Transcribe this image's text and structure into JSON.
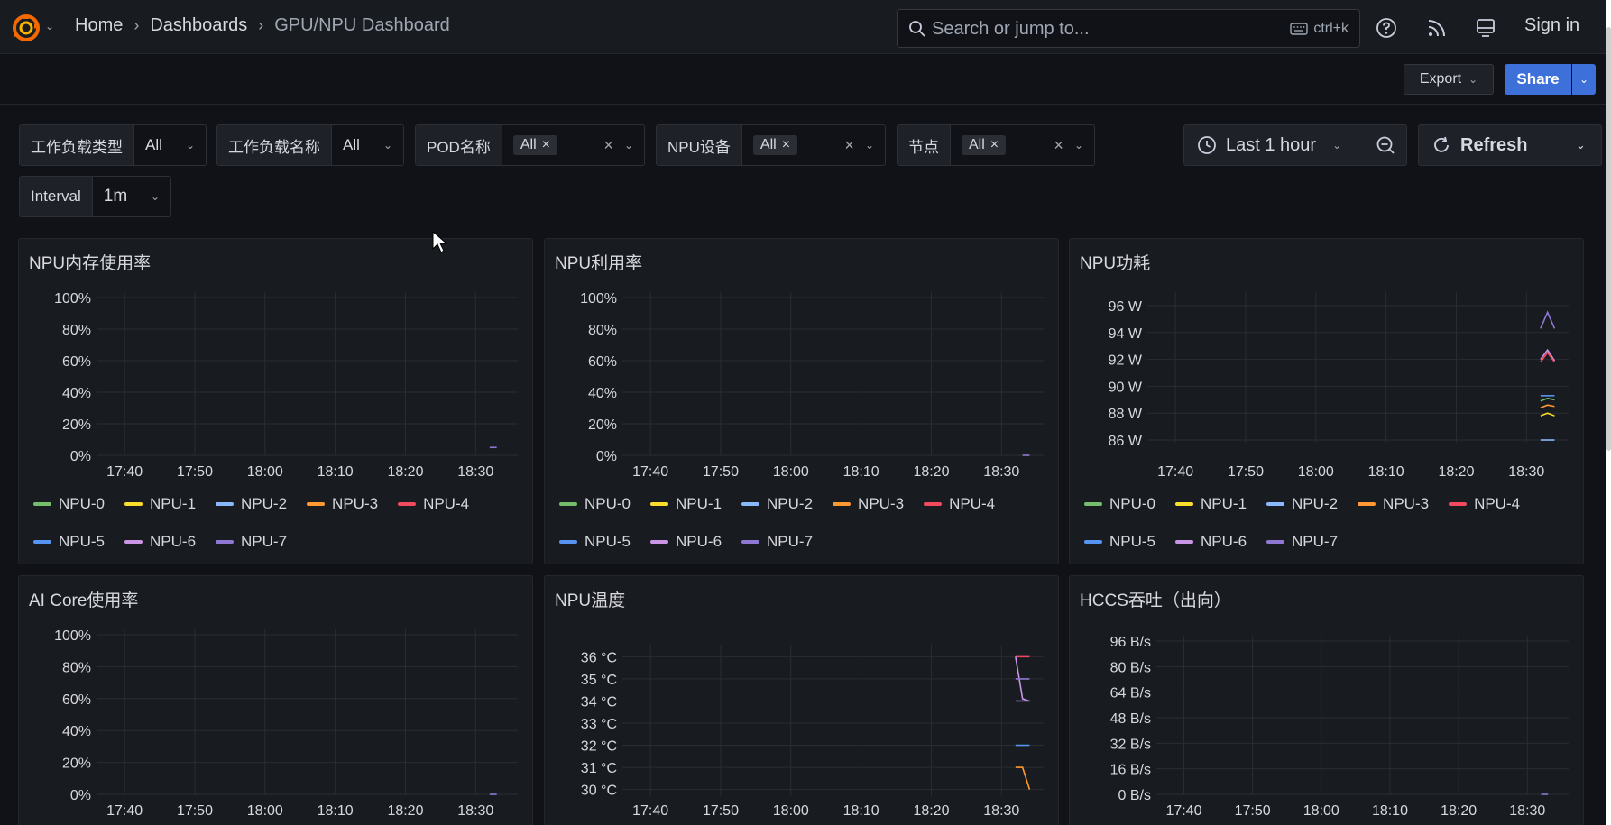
{
  "colors": {
    "bg": "#111217",
    "panel": "#181b1f",
    "accent": "#3d71d9",
    "logo": "#f46800"
  },
  "header": {
    "breadcrumb": [
      "Home",
      "Dashboards",
      "GPU/NPU Dashboard"
    ],
    "search_placeholder": "Search or jump to...",
    "search_shortcut": "ctrl+k",
    "icons": [
      "help-icon",
      "rss-icon",
      "kiosk-icon"
    ],
    "signin_label": "Sign in"
  },
  "toolbar": {
    "export_label": "Export",
    "share_label": "Share"
  },
  "variables": [
    {
      "label": "工作负载类型",
      "value": "All",
      "chip": false
    },
    {
      "label": "工作负载名称",
      "value": "All",
      "chip": false
    },
    {
      "label": "POD名称",
      "value": "All",
      "chip": true
    },
    {
      "label": "NPU设备",
      "value": "All",
      "chip": true
    },
    {
      "label": "节点",
      "value": "All",
      "chip": true
    },
    {
      "label": "Interval",
      "value": "1m",
      "chip": false
    }
  ],
  "time": {
    "range_label": "Last 1 hour",
    "refresh_label": "Refresh"
  },
  "series_names": [
    "NPU-0",
    "NPU-1",
    "NPU-2",
    "NPU-3",
    "NPU-4",
    "NPU-5",
    "NPU-6",
    "NPU-7"
  ],
  "series_colors": [
    "#73bf69",
    "#fade2a",
    "#8ab8ff",
    "#ff9830",
    "#f2495c",
    "#5794f2",
    "#ca95e5",
    "#8f78d3"
  ],
  "panels": [
    {
      "title": "NPU内存使用率",
      "legend": true
    },
    {
      "title": "NPU利用率",
      "legend": true
    },
    {
      "title": "NPU功耗",
      "legend": true
    },
    {
      "title": "AI Core使用率",
      "legend": false
    },
    {
      "title": "NPU温度",
      "legend": false
    },
    {
      "title": "HCCS吞吐（出向）",
      "legend": false
    }
  ],
  "chart_data": [
    {
      "type": "line",
      "title": "NPU内存使用率",
      "x_ticks": [
        "17:40",
        "17:50",
        "18:00",
        "18:10",
        "18:20",
        "18:30"
      ],
      "y_ticks": [
        "0%",
        "20%",
        "40%",
        "60%",
        "80%",
        "100%"
      ],
      "ylim": [
        0,
        100
      ],
      "series": [
        {
          "name": "NPU-7",
          "x": [
            "18:32",
            "18:33"
          ],
          "values": [
            5,
            5
          ]
        }
      ]
    },
    {
      "type": "line",
      "title": "NPU利用率",
      "x_ticks": [
        "17:40",
        "17:50",
        "18:00",
        "18:10",
        "18:20",
        "18:30"
      ],
      "y_ticks": [
        "0%",
        "20%",
        "40%",
        "60%",
        "80%",
        "100%"
      ],
      "ylim": [
        0,
        100
      ],
      "series": [
        {
          "name": "NPU-7",
          "x": [
            "18:33",
            "18:34"
          ],
          "values": [
            0,
            0
          ]
        }
      ]
    },
    {
      "type": "line",
      "title": "NPU功耗",
      "x_ticks": [
        "17:40",
        "17:50",
        "18:00",
        "18:10",
        "18:20",
        "18:30"
      ],
      "y_ticks": [
        "86 W",
        "88 W",
        "90 W",
        "92 W",
        "94 W",
        "96 W"
      ],
      "ylim": [
        85.8,
        96.6
      ],
      "series": [
        {
          "name": "NPU-7",
          "x": [
            "18:32",
            "18:33",
            "18:34"
          ],
          "values": [
            94.3,
            95.5,
            94.3
          ]
        },
        {
          "name": "NPU-6",
          "x": [
            "18:32",
            "18:33",
            "18:34"
          ],
          "values": [
            92.0,
            92.7,
            91.9
          ]
        },
        {
          "name": "NPU-4",
          "x": [
            "18:32",
            "18:33",
            "18:34"
          ],
          "values": [
            91.8,
            92.5,
            91.8
          ]
        },
        {
          "name": "NPU-5",
          "x": [
            "18:32",
            "18:34"
          ],
          "values": [
            89.3,
            89.3
          ]
        },
        {
          "name": "NPU-0",
          "x": [
            "18:32",
            "18:33",
            "18:34"
          ],
          "values": [
            88.9,
            89.1,
            89.0
          ]
        },
        {
          "name": "NPU-3",
          "x": [
            "18:32",
            "18:33",
            "18:34"
          ],
          "values": [
            88.4,
            88.6,
            88.5
          ]
        },
        {
          "name": "NPU-1",
          "x": [
            "18:32",
            "18:33",
            "18:34"
          ],
          "values": [
            87.8,
            88.0,
            87.8
          ]
        },
        {
          "name": "NPU-2",
          "x": [
            "18:32",
            "18:34"
          ],
          "values": [
            86.0,
            86.0
          ]
        }
      ]
    },
    {
      "type": "line",
      "title": "AI Core使用率",
      "x_ticks": [
        "17:40",
        "17:50",
        "18:00",
        "18:10",
        "18:20",
        "18:30"
      ],
      "y_ticks": [
        "0%",
        "20%",
        "40%",
        "60%",
        "80%",
        "100%"
      ],
      "ylim": [
        0,
        100
      ],
      "series": [
        {
          "name": "NPU-7",
          "x": [
            "18:32",
            "18:33"
          ],
          "values": [
            0,
            0
          ]
        }
      ]
    },
    {
      "type": "line",
      "title": "NPU温度",
      "x_ticks": [
        "17:40",
        "17:50",
        "18:00",
        "18:10",
        "18:20",
        "18:30"
      ],
      "y_ticks": [
        "30 °C",
        "31 °C",
        "32 °C",
        "33 °C",
        "34 °C",
        "35 °C",
        "36 °C"
      ],
      "ylim": [
        29.7,
        36.3
      ],
      "series": [
        {
          "name": "NPU-4",
          "x": [
            "18:32",
            "18:34"
          ],
          "values": [
            36,
            36
          ]
        },
        {
          "name": "NPU-6",
          "x": [
            "18:32",
            "18:33",
            "18:34"
          ],
          "values": [
            36,
            34.1,
            34
          ]
        },
        {
          "name": "NPU-7",
          "x": [
            "18:32",
            "18:34"
          ],
          "values": [
            35,
            35
          ]
        },
        {
          "name": "NPU-7",
          "x": [
            "18:32",
            "18:34"
          ],
          "values": [
            34,
            34
          ]
        },
        {
          "name": "NPU-5",
          "x": [
            "18:32",
            "18:34"
          ],
          "values": [
            32,
            32
          ]
        },
        {
          "name": "NPU-3",
          "x": [
            "18:32",
            "18:33",
            "18:34"
          ],
          "values": [
            31,
            31,
            30
          ]
        }
      ]
    },
    {
      "type": "line",
      "title": "HCCS吞吐（出向）",
      "x_ticks": [
        "17:40",
        "17:50",
        "18:00",
        "18:10",
        "18:20",
        "18:30"
      ],
      "y_ticks": [
        "0 B/s",
        "16 B/s",
        "32 B/s",
        "48 B/s",
        "64 B/s",
        "80 B/s",
        "96 B/s"
      ],
      "ylim": [
        0,
        96
      ],
      "series": [
        {
          "name": "NPU-7",
          "x": [
            "18:32",
            "18:33"
          ],
          "values": [
            0,
            0
          ]
        }
      ]
    }
  ]
}
